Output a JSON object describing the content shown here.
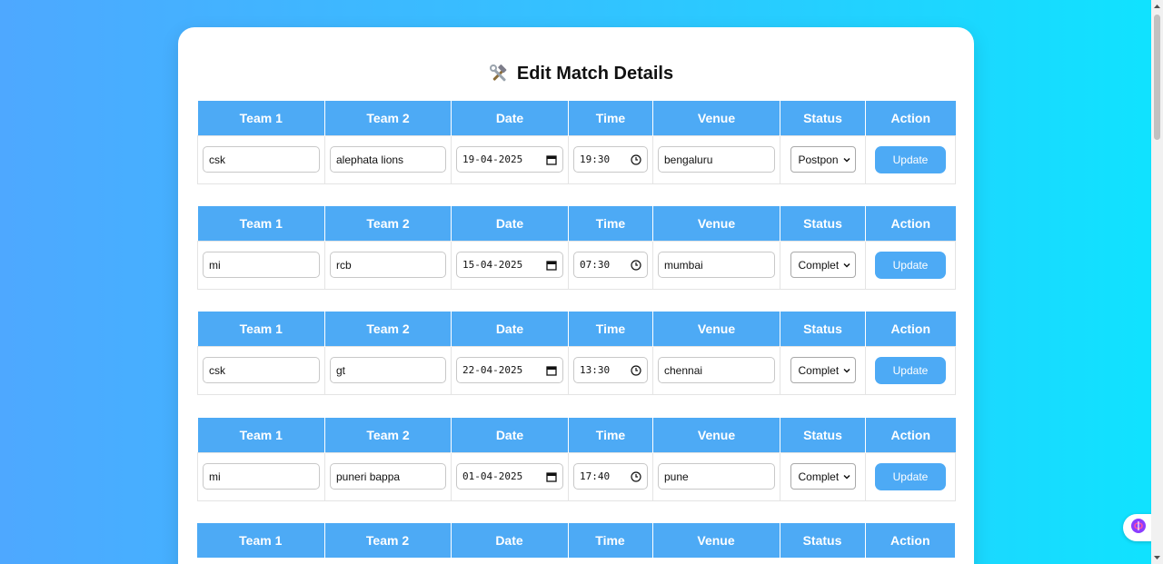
{
  "page": {
    "title": "Edit Match Details",
    "title_icon": "hammer-wrench-icon"
  },
  "headers": [
    "Team 1",
    "Team 2",
    "Date",
    "Time",
    "Venue",
    "Status",
    "Action"
  ],
  "matches": [
    {
      "team1": "csk",
      "team2": "alephata lions",
      "date": "19-04-2025",
      "time": "19:30",
      "venue": "bengaluru",
      "status": "Postpon",
      "action": "Update"
    },
    {
      "team1": "mi",
      "team2": "rcb",
      "date": "15-04-2025",
      "time": "07:30",
      "venue": "mumbai",
      "status": "Complet",
      "action": "Update"
    },
    {
      "team1": "csk",
      "team2": "gt",
      "date": "22-04-2025",
      "time": "13:30",
      "venue": "chennai",
      "status": "Complet",
      "action": "Update"
    },
    {
      "team1": "mi",
      "team2": "puneri bappa",
      "date": "01-04-2025",
      "time": "17:40",
      "venue": "pune",
      "status": "Complet",
      "action": "Update"
    }
  ],
  "colors": {
    "header_bg": "#4daaf5",
    "button_bg": "#4daaf5",
    "page_gradient_start": "#4ea8ff",
    "page_gradient_end": "#0fe3ff"
  }
}
